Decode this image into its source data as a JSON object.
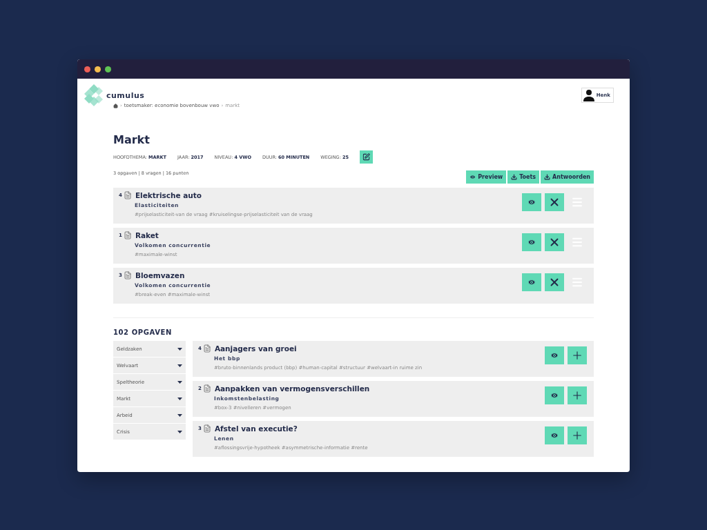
{
  "app": {
    "name": "cumulus",
    "user": "Henk"
  },
  "breadcrumb": {
    "separator": "›",
    "items": [
      "toetsmaker: economie bovenbouw vwo",
      "markt"
    ]
  },
  "title": "Markt",
  "meta": [
    {
      "label": "HOOFDTHEMA:",
      "value": "MARKT"
    },
    {
      "label": "JAAR:",
      "value": "2017"
    },
    {
      "label": "NIVEAU:",
      "value": "4 VWO"
    },
    {
      "label": "DUUR:",
      "value": "60 MINUTEN"
    },
    {
      "label": "WEGING:",
      "value": "25"
    }
  ],
  "summary": "3 opgaven | 8 vragen | 16 punten",
  "actions": [
    {
      "kind": "view",
      "label": "Preview"
    },
    {
      "kind": "download",
      "label": "Toets"
    },
    {
      "kind": "download",
      "label": "Antwoorden"
    }
  ],
  "selected": [
    {
      "count": "4",
      "title": "Elektrische auto",
      "subtitle": "Elasticiteiten",
      "tags": "#prijselasticiteit-van de vraag #kruiselingse-prijselasticiteit van de vraag"
    },
    {
      "count": "1",
      "title": "Raket",
      "subtitle": "Volkomen concurrentie",
      "tags": "#maximale-winst"
    },
    {
      "count": "3",
      "title": "Bloemvazen",
      "subtitle": "Volkomen concurrentie",
      "tags": "#break-even #maximale-winst"
    }
  ],
  "library": {
    "heading": "102 OPGAVEN",
    "filters": [
      {
        "label": "Geldzaken",
        "expanded": false
      },
      {
        "label": "Welvaart",
        "expanded": false
      },
      {
        "label": "Speltheorie",
        "expanded": false
      },
      {
        "label": "Markt",
        "expanded": false
      },
      {
        "label": "Arbeid",
        "expanded": false
      },
      {
        "label": "Crisis",
        "expanded": false
      }
    ],
    "items": [
      {
        "count": "4",
        "title": "Aanjagers van groei",
        "subtitle": "Het bbp",
        "tags": "#bruto-binnenlands product (bbp) #human-capital #structuur #welvaart-in ruime zin"
      },
      {
        "count": "2",
        "title": "Aanpakken van vermogensverschillen",
        "subtitle": "Inkomstenbelasting",
        "tags": "#box-3 #nivelleren #vermogen"
      },
      {
        "count": "3",
        "title": "Afstel van executie?",
        "subtitle": "Lenen",
        "tags": "#aflossingsvrije-hypotheek #asymmetrische-informatie #rente"
      }
    ]
  }
}
